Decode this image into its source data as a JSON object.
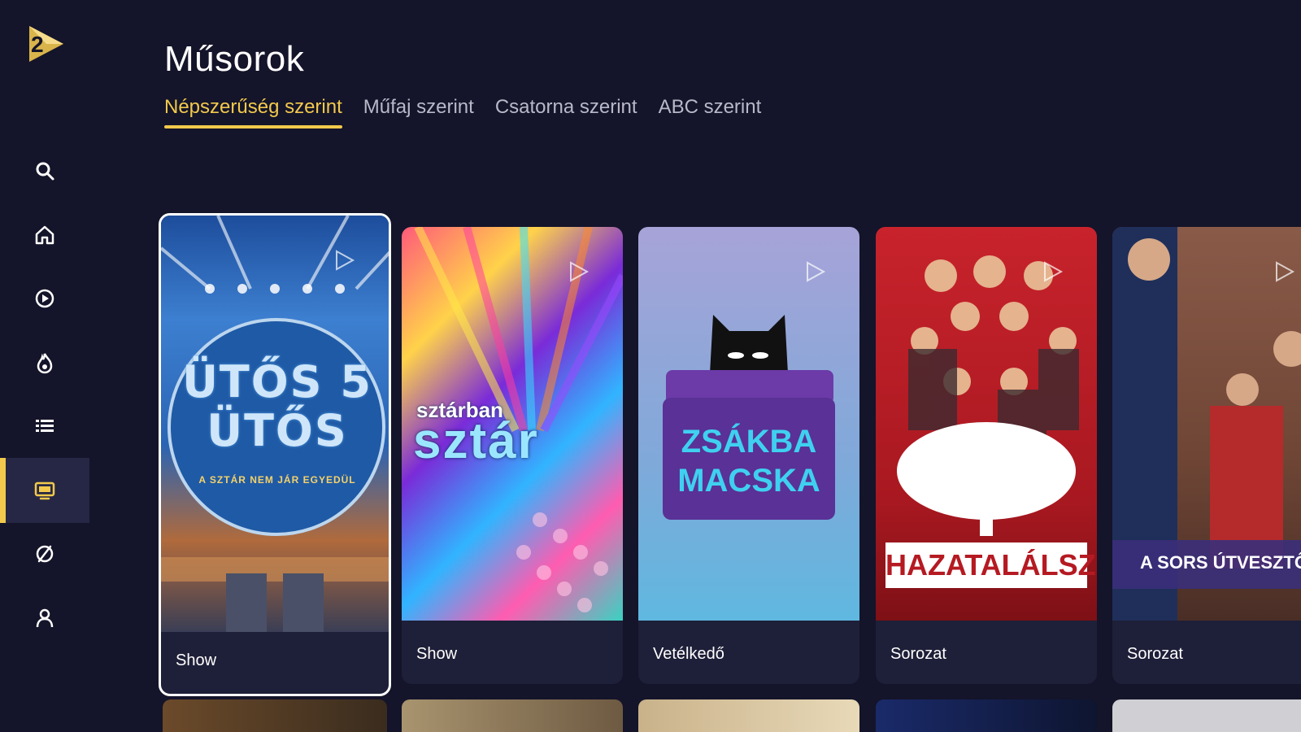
{
  "app": {
    "logo_alt": "2",
    "accent": "#f2c94c",
    "background": "#14142a"
  },
  "sidebar": {
    "items": [
      {
        "icon": "search-icon",
        "active": false
      },
      {
        "icon": "home-icon",
        "active": false
      },
      {
        "icon": "play-circle-icon",
        "active": false
      },
      {
        "icon": "flame-icon",
        "active": false
      },
      {
        "icon": "list-icon",
        "active": false
      },
      {
        "icon": "tv-icon",
        "active": true
      },
      {
        "icon": "slash-circle-icon",
        "active": false
      },
      {
        "icon": "user-icon",
        "active": false
      }
    ]
  },
  "header": {
    "title": "Műsorok",
    "tabs": [
      {
        "label": "Népszerűség szerint",
        "active": true
      },
      {
        "label": "Műfaj szerint",
        "active": false
      },
      {
        "label": "Csatorna szerint",
        "active": false
      },
      {
        "label": "ABC szerint",
        "active": false
      }
    ]
  },
  "cards": [
    {
      "title": "ÜTŐS 5 ÜTŐS",
      "subtitle": "A SZTÁR NEM JÁR EGYEDÜL",
      "category": "Show",
      "focused": true
    },
    {
      "title_small": "sztárban",
      "title": "sztár",
      "category": "Show",
      "focused": false
    },
    {
      "title": "ZSÁKBA",
      "title2": "MACSKA",
      "category": "Vetélkedő",
      "focused": false
    },
    {
      "title": "HAZATALÁLSZ",
      "category": "Sorozat",
      "focused": false
    },
    {
      "title": "A SORS ÚTVESZTŐ",
      "category": "Sorozat",
      "focused": false
    }
  ]
}
